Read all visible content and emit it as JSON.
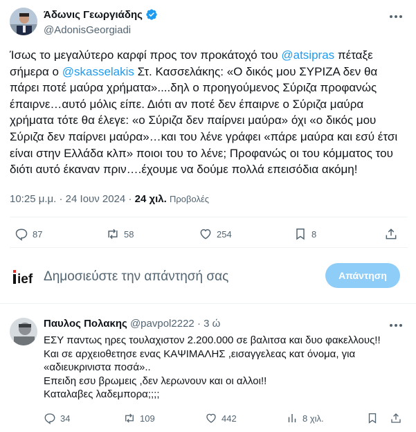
{
  "tweet": {
    "author_name": "Άδωνις Γεωργιάδης",
    "author_handle": "@AdonisGeorgiadi",
    "lines": [
      [
        {
          "t": "Ίσως το μεγαλύτερο καρφί προς τον προκάτοχό του "
        },
        {
          "t": "@atsipras",
          "m": true
        },
        {
          "t": " πέταξε"
        }
      ],
      [
        {
          "t": "σήμερα ο "
        },
        {
          "t": "@skasselakis",
          "m": true
        },
        {
          "t": " Στ. Κασσελάκης: «Ο δικός μου ΣΥΡΙΖΑ δεν θα"
        }
      ],
      [
        {
          "t": "πάρει ποτέ μαύρα χρήματα»....δηλ ο προηγούμενος Σύριζα προφανώς"
        }
      ],
      [
        {
          "t": "έπαιρνε…αυτό μόλις είπε. Διότι αν ποτέ δεν έπαιρνε ο Σύριζα μαύρα"
        }
      ],
      [
        {
          "t": "χρήματα τότε θα έλεγε: «ο Σύριζα δεν παίρνει μαύρα» όχι «ο δικός μου"
        }
      ],
      [
        {
          "t": "Σύριζα δεν παίρνει μαύρα»…και του λένε γράφει «πάρε μαύρα και εσύ έτσι"
        }
      ],
      [
        {
          "t": "είναι στην Ελλάδα κλπ» ποιοι του το λένε; Προφανώς οι του κόμματος του"
        }
      ],
      [
        {
          "t": "διότι αυτό έκαναν πριν….έχουμε να δούμε πολλά επεισόδια ακόμη!"
        }
      ]
    ],
    "time": "10:25 μ.μ.",
    "dot": "·",
    "date": "24 Ιουν 2024",
    "views_count": "24 χιλ.",
    "views_label": "Προβολές",
    "stats": {
      "replies": "87",
      "retweets": "58",
      "likes": "254",
      "bookmarks": "8"
    }
  },
  "composer": {
    "logo_text": "ief",
    "placeholder": "Δημοσιεύστε την απάντησή σας",
    "button": "Απάντηση"
  },
  "reply": {
    "author_name": "Παυλος Πολακης",
    "author_handle": "@pavpol2222",
    "dot": "·",
    "time": "3 ώ",
    "lines": [
      "ΕΣΥ παντως  ηρες τουλαχιστον 2.200.000 σε βαλιτσα και δυο φακελλους!!",
      "Και σε αρχειοθετησε ενας ΚΑΨΙΜΑΛΗΣ ,εισαγγελεας κατ όνομα, για",
      "«αδιευκρινιστα ποσά»..",
      "Επειδη εσυ βρωμεις ,δεν λερωνουν και οι αλλοι!!",
      "Καταλαβες λαδεμπορα;;;;"
    ],
    "stats": {
      "replies": "34",
      "retweets": "109",
      "likes": "442",
      "views": "8 χιλ."
    }
  },
  "colors": {
    "accent": "#1d9bf0",
    "muted": "#536471",
    "text": "#0f1419",
    "reply_button": "#8ecdf8",
    "verified": "#1d9bf0"
  }
}
